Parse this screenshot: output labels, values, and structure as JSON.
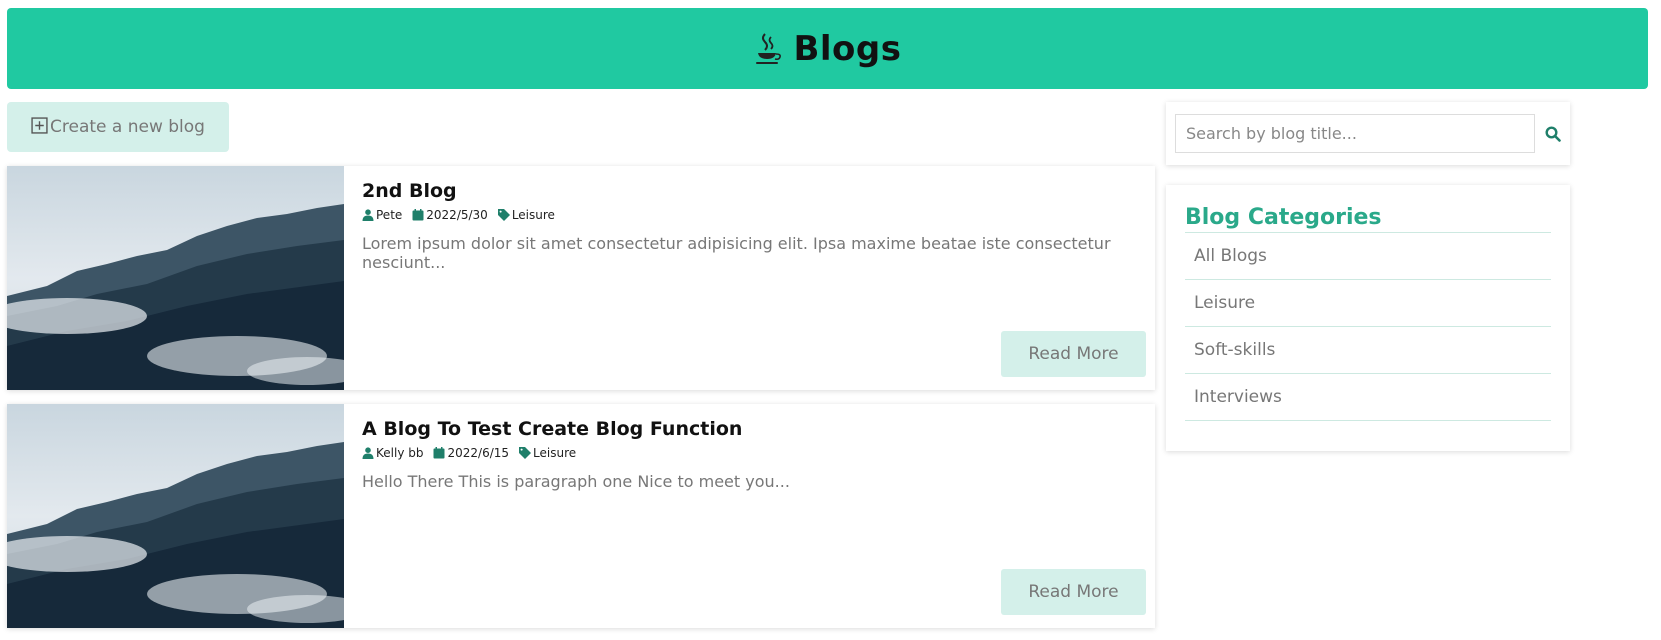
{
  "header": {
    "title": "Blogs",
    "icon": "java-cup-icon"
  },
  "toolbar": {
    "create_label": "Create a new blog",
    "create_icon": "plus-square-icon"
  },
  "blogs": [
    {
      "title": "2nd Blog",
      "author": "Pete",
      "date": "2022/5/30",
      "category": "Leisure",
      "excerpt": "Lorem ipsum dolor sit amet consectetur adipisicing elit. Ipsa maxime beatae iste consectetur nesciunt...",
      "read_more": "Read More"
    },
    {
      "title": "A Blog To Test Create Blog Function",
      "author": "Kelly bb",
      "date": "2022/6/15",
      "category": "Leisure",
      "excerpt": "Hello There This is paragraph one Nice to meet you...",
      "read_more": "Read More"
    }
  ],
  "search": {
    "placeholder": "Search by blog title...",
    "value": ""
  },
  "categories": {
    "heading": "Blog Categories",
    "items": [
      {
        "label": "All Blogs"
      },
      {
        "label": "Leisure"
      },
      {
        "label": "Soft-skills"
      },
      {
        "label": "Interviews"
      }
    ]
  },
  "colors": {
    "accent": "#20c9a1",
    "button_bg": "#d4f0ea",
    "meta_icon": "#1f7f6a",
    "heading": "#2aa98a"
  }
}
